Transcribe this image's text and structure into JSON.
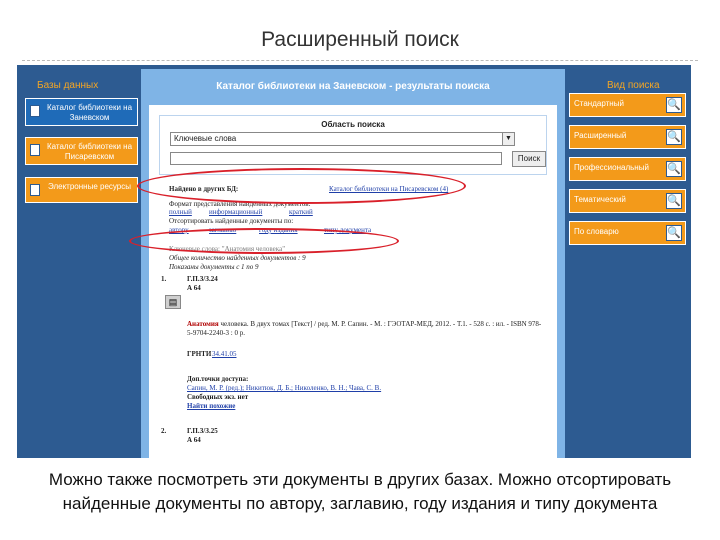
{
  "slide": {
    "title": "Расширенный поиск",
    "caption": "Можно также посмотреть эти документы в других базах. Можно отсортировать найденные документы  по автору, заглавию, году издания и типу документа"
  },
  "sidebar_left": {
    "title": "Базы данных",
    "items": [
      {
        "label": "Каталог библиотеки на Заневском"
      },
      {
        "label": "Каталог библиотеки на Писаревском"
      },
      {
        "label": "Электронные ресурсы"
      }
    ]
  },
  "sidebar_right": {
    "title": "Вид поиска",
    "items": [
      {
        "label": "Стандартный"
      },
      {
        "label": "Расширенный"
      },
      {
        "label": "Профессиональный"
      },
      {
        "label": "Тематический"
      },
      {
        "label": "По словарю"
      }
    ],
    "icon": "magnifier-icon"
  },
  "center": {
    "header": "Каталог библиотеки на Заневском - результаты поиска",
    "search_area_label": "Область поиска",
    "search_field_value": "Ключевые слова",
    "search_button": "Поиск",
    "other_db_label": "Найдено в других БД:",
    "other_db_link": "Каталог библиотеки на Писаревском (4)",
    "format_line": "Формат представления найденных документов:",
    "format_options": [
      "полный",
      "информационный",
      "краткий"
    ],
    "sort_label": "Отсортировать найденные документы по:",
    "sort_options": [
      "автору",
      "заглавию",
      "году издания",
      "типу документа"
    ],
    "query_line": "Ключевые слова: \"Анатомия человека\"",
    "found_line": "Общее количество найденных документов : 9",
    "shown_line": "Показаны документы с 1 по 9",
    "result1": {
      "number": "1.",
      "code1": "Г.П.З/З.24",
      "code2": "А 64",
      "title": "Анатомия",
      "desc": "человека. В двух томах [Текст] / ред. М. Р. Сапин. - М. : ГЭОТАР-МЕД, 2012. - Т.1. - 528 с. : ил. - ISBN 978-5-9704-2240-3 : 0 р.",
      "grnti_label": "ГРНТИ",
      "grnti_value": "34.41.05",
      "access_label": "Доп.точки доступа:",
      "access_value": "Сапин, М. Р. (ред.); Никитюк, Д. Б.; Николенко, В. Н.; Чава, С. В.",
      "free_label": "Свободных экз. нет",
      "find_similar": "Найти похожие"
    },
    "result2": {
      "number": "2.",
      "code1": "Г.П.З/З.25",
      "code2": "А 64"
    }
  }
}
